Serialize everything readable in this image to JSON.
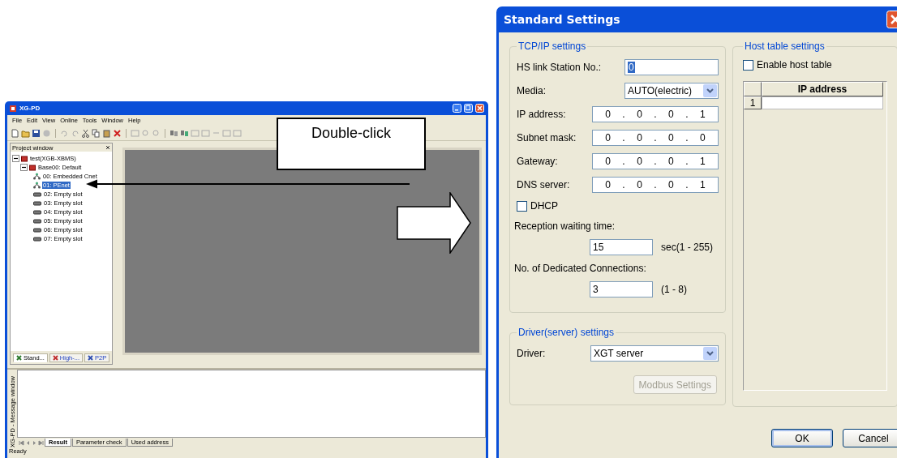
{
  "xg_pd_window": {
    "title": "XG-PD",
    "menu": [
      "File",
      "Edit",
      "View",
      "Online",
      "Tools",
      "Window",
      "Help"
    ],
    "project_window": {
      "title": "Project window",
      "tree": [
        {
          "label": "test(XGB-XBMS)",
          "kind": "project",
          "expanded": true,
          "selected": false,
          "children": [
            {
              "label": "Base00: Default",
              "kind": "base",
              "expanded": true,
              "selected": false,
              "children": [
                {
                  "label": "00: Embedded Cnet",
                  "kind": "module",
                  "selected": false
                },
                {
                  "label": "01: PEnet",
                  "kind": "module",
                  "selected": true
                },
                {
                  "label": "02: Empty slot",
                  "kind": "slot",
                  "selected": false
                },
                {
                  "label": "03: Empty slot",
                  "kind": "slot",
                  "selected": false
                },
                {
                  "label": "04: Empty slot",
                  "kind": "slot",
                  "selected": false
                },
                {
                  "label": "05: Empty slot",
                  "kind": "slot",
                  "selected": false
                },
                {
                  "label": "06: Empty slot",
                  "kind": "slot",
                  "selected": false
                },
                {
                  "label": "07: Empty slot",
                  "kind": "slot",
                  "selected": false
                }
              ]
            }
          ]
        }
      ],
      "tabs": [
        {
          "label": "Stand...",
          "selected": true
        },
        {
          "label": "High-...",
          "selected": false
        },
        {
          "label": "P2P",
          "selected": false
        }
      ]
    },
    "message_window": {
      "title": "XG-PD - Message window",
      "tabs": [
        {
          "label": "Result",
          "selected": true
        },
        {
          "label": "Parameter check",
          "selected": false
        },
        {
          "label": "Used address",
          "selected": false
        }
      ]
    },
    "status_bar": "Ready"
  },
  "callout": {
    "text": "Double-click"
  },
  "dialog": {
    "title": "Standard Settings",
    "tcp_ip": {
      "title": "TCP/IP settings",
      "fields": [
        {
          "kind": "text",
          "label": "HS link Station No.:",
          "value": "0",
          "highlighted": true
        },
        {
          "kind": "dropdown",
          "label": "Media:",
          "value": "AUTO(electric)"
        },
        {
          "kind": "ip",
          "label": "IP address:",
          "octets": [
            "0",
            "0",
            "0",
            "1"
          ],
          "separators": [
            ".",
            ".",
            "."
          ]
        },
        {
          "kind": "ip",
          "label": "Subnet mask:",
          "octets": [
            "0",
            "0",
            "0",
            "0"
          ],
          "separators": [
            ".",
            ".",
            "."
          ]
        },
        {
          "kind": "ip",
          "label": "Gateway:",
          "octets": [
            "0",
            "0",
            "0",
            "1"
          ],
          "separators": [
            ".",
            ".",
            "."
          ]
        },
        {
          "kind": "ip",
          "label": "DNS server:",
          "octets": [
            "0",
            "0",
            "0",
            "1"
          ],
          "separators": [
            ".",
            ".",
            "."
          ]
        },
        {
          "kind": "checkbox",
          "label": "DHCP",
          "checked": false
        },
        {
          "kind": "number",
          "label": "Reception waiting time:",
          "value": "15",
          "unit": "sec(1 - 255)"
        },
        {
          "kind": "number",
          "label": "No. of Dedicated Connections:",
          "value": "3",
          "unit": "(1 - 8)"
        }
      ]
    },
    "driver": {
      "title": "Driver(server) settings",
      "fields": [
        {
          "kind": "dropdown",
          "label": "Driver:",
          "value": "XGT server"
        }
      ],
      "button": {
        "label": "Modbus Settings",
        "disabled": true
      }
    },
    "host_table": {
      "title": "Host table settings",
      "enable": {
        "label": "Enable host table",
        "checked": false
      },
      "columns": [
        "IP address"
      ],
      "rows": [
        {
          "number": "1"
        }
      ]
    },
    "buttons": [
      {
        "label": "OK",
        "default": true
      },
      {
        "label": "Cancel",
        "default": false
      }
    ]
  }
}
